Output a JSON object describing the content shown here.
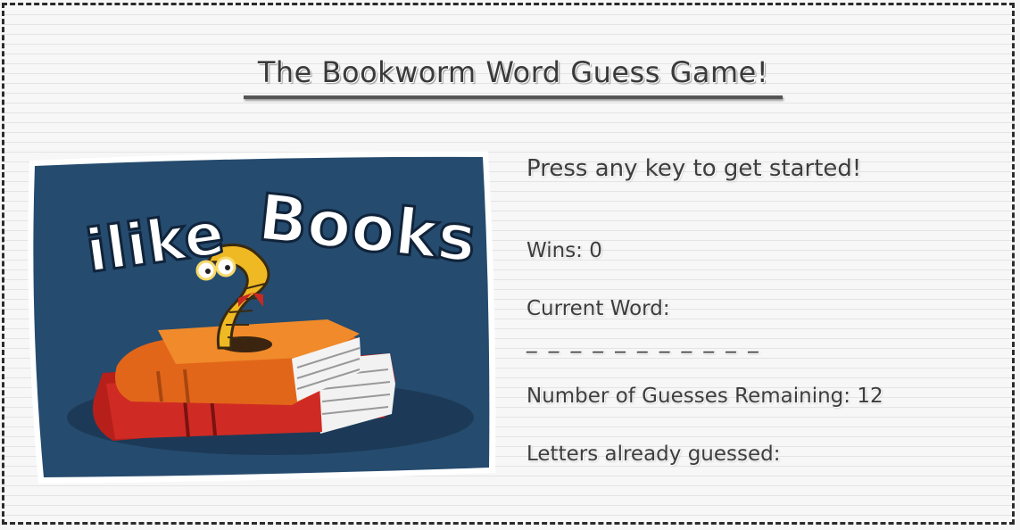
{
  "header": {
    "title": "The Bookworm Word Guess Game!"
  },
  "image": {
    "caption": "ilike Books",
    "caption_text_line1": "ilike",
    "caption_text_line2": "Books"
  },
  "game": {
    "prompt": "Press any key to get started!",
    "wins_label": "Wins: 0",
    "current_word_label": "Current Word:",
    "current_word_blanks": "_ _ _ _ _  _ _ _ _ _ _",
    "guesses_remaining_label": "Number of Guesses Remaining: 12",
    "letters_guessed_label": "Letters already guessed:"
  },
  "colors": {
    "frame_border": "#2b2b2b",
    "art_background": "#254b6e",
    "book_top": "#ee7a1f",
    "book_bottom": "#c1251f",
    "worm": "#f1bf2a"
  }
}
